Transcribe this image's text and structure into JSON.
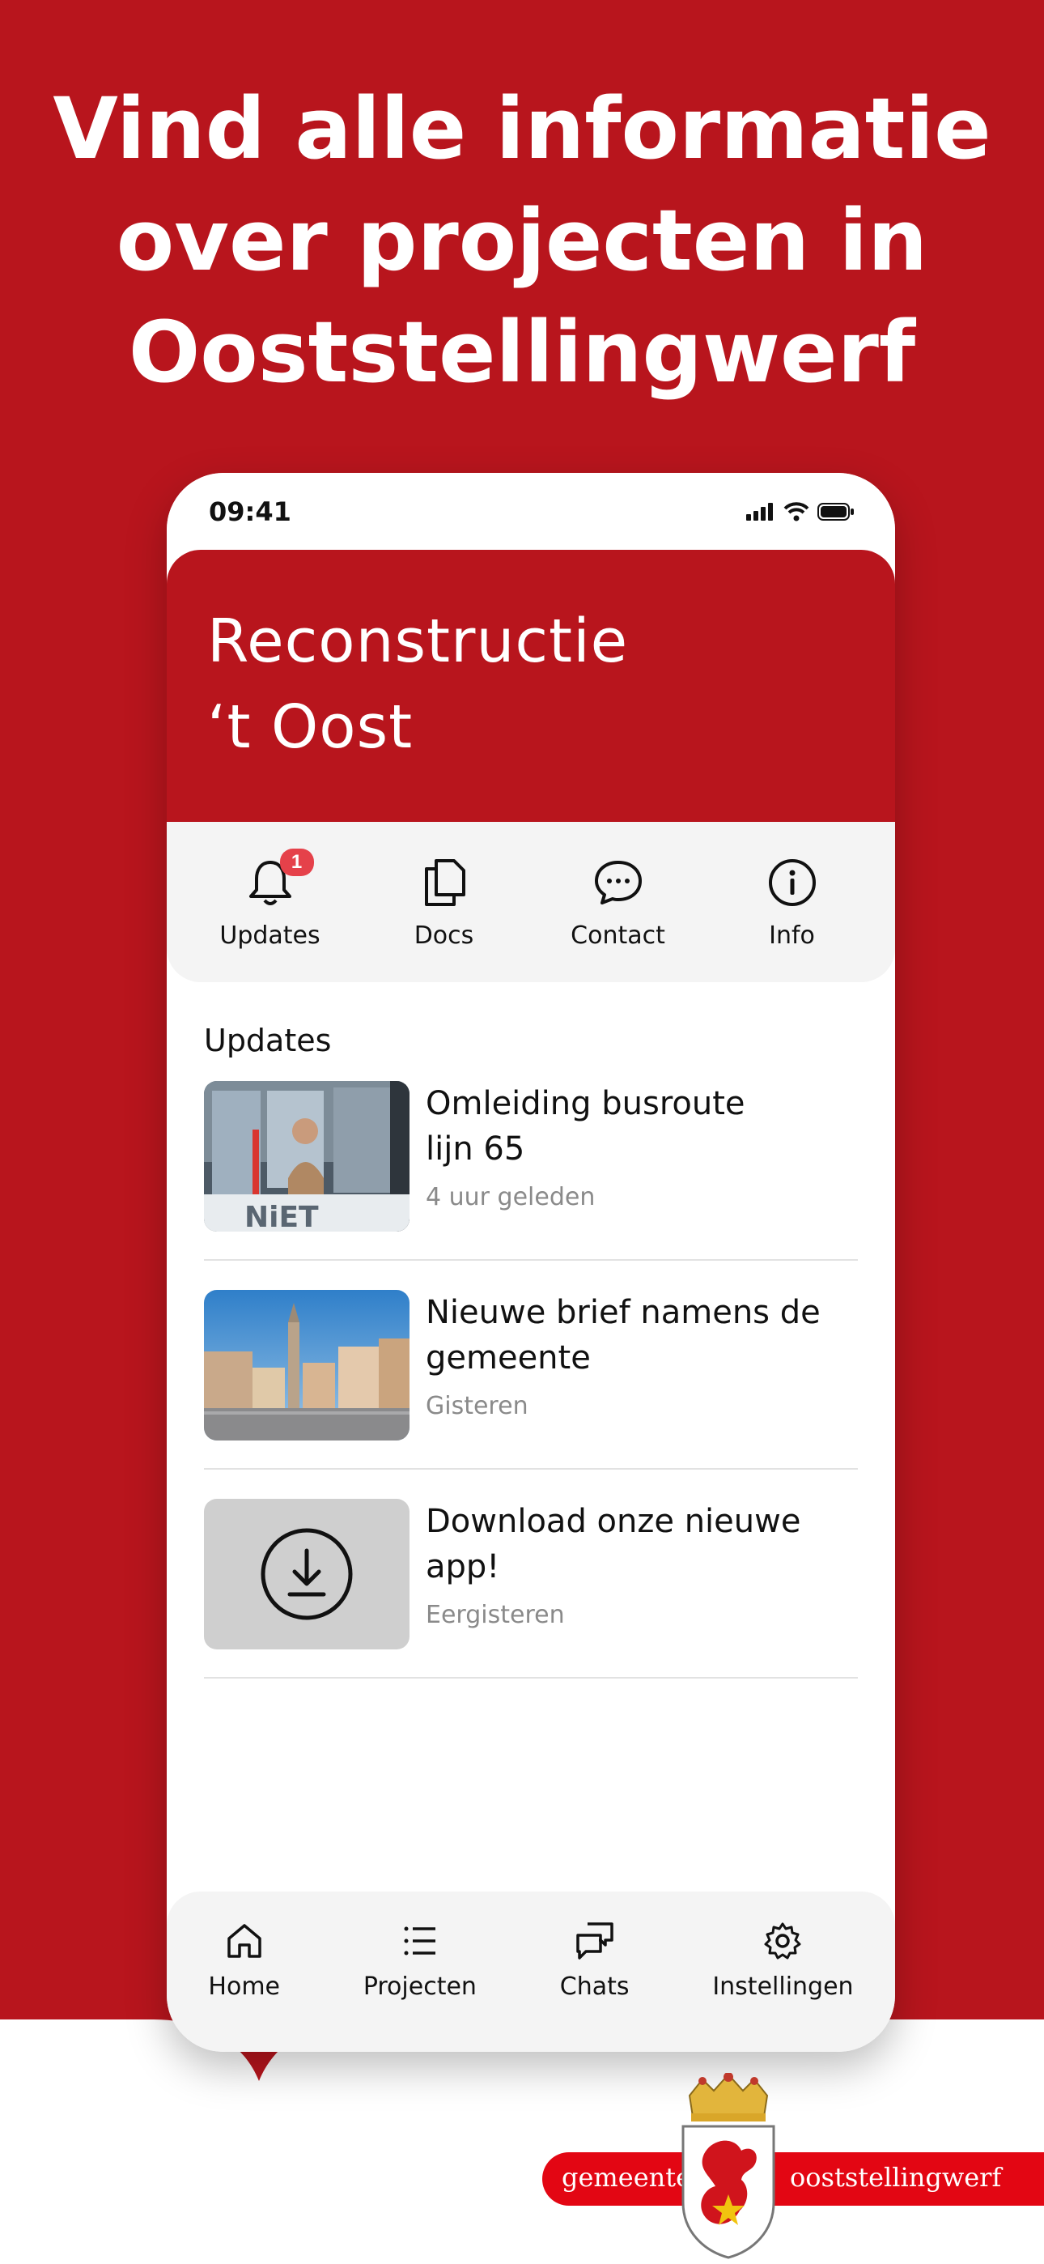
{
  "headline": [
    "Vind alle informatie",
    "over projecten in",
    "Ooststellingwerf"
  ],
  "status": {
    "time": "09:41"
  },
  "header": {
    "title_lines": [
      "Reconstructie",
      "‘t Oost"
    ]
  },
  "quick_actions": [
    {
      "label": "Updates",
      "icon": "bell-icon",
      "badge": "1"
    },
    {
      "label": "Docs",
      "icon": "documents-icon"
    },
    {
      "label": "Contact",
      "icon": "chat-bubble-icon"
    },
    {
      "label": "Info",
      "icon": "info-icon"
    }
  ],
  "section": {
    "title": "Updates"
  },
  "updates": [
    {
      "title_lines": [
        "Omleiding busroute",
        "lijn 65"
      ],
      "time": "4 uur geleden",
      "image": "bus-photo"
    },
    {
      "title_lines": [
        "Nieuwe brief namens de",
        "gemeente"
      ],
      "time": "Gisteren",
      "image": "town-square-photo"
    },
    {
      "title_lines": [
        "Download onze nieuwe",
        "app!"
      ],
      "time": "Eergisteren",
      "image": "download-icon"
    }
  ],
  "tabbar": [
    {
      "label": "Home",
      "icon": "home-icon"
    },
    {
      "label": "Projecten",
      "icon": "list-icon"
    },
    {
      "label": "Chats",
      "icon": "chats-icon"
    },
    {
      "label": "Instellingen",
      "icon": "gear-icon"
    }
  ],
  "logo": {
    "left": "gemeente",
    "right": "ooststellingwerf"
  },
  "colors": {
    "brand": "#b8151d",
    "badge": "#e5414a",
    "panel": "#f4f4f4",
    "muted": "#8a8a8a"
  }
}
